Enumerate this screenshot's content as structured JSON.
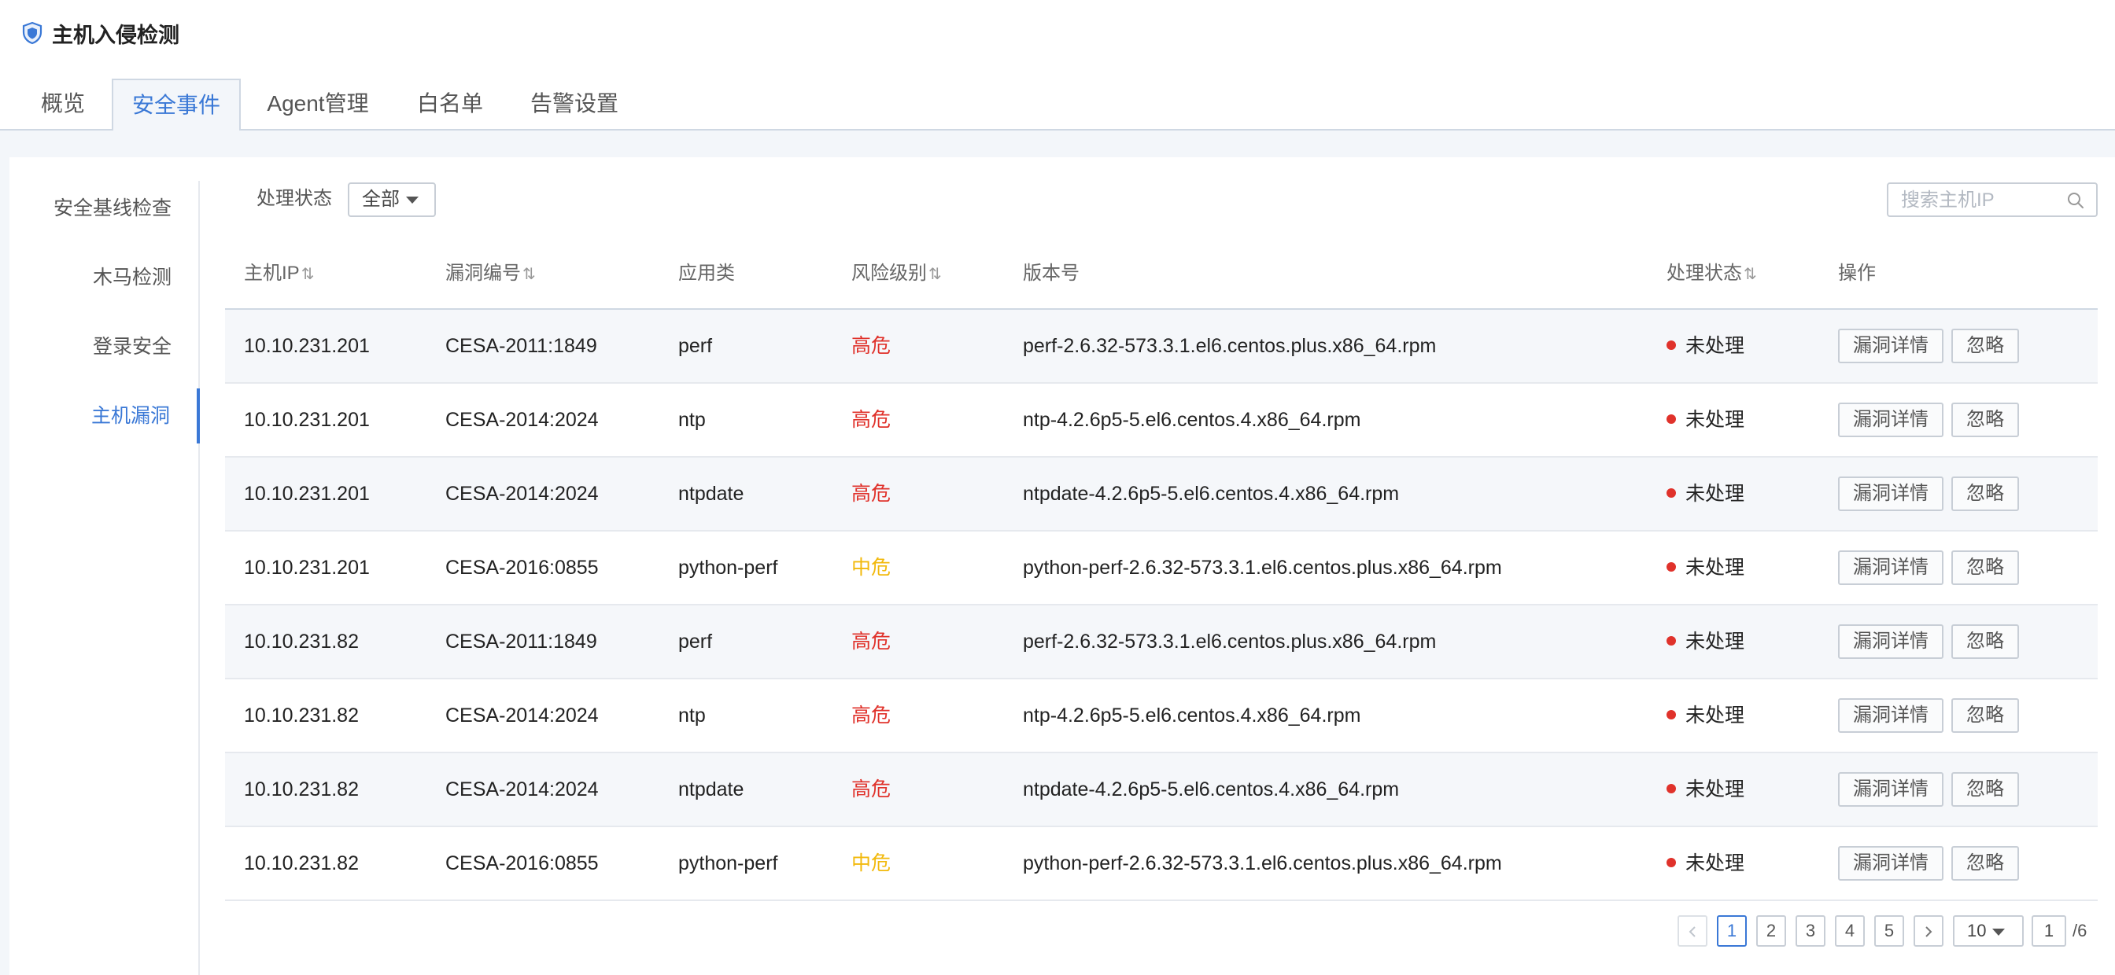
{
  "app": {
    "title": "主机入侵检测",
    "logo_icon": "shield-icon",
    "accent_color": "#3a78d6"
  },
  "tabs": [
    {
      "label": "概览"
    },
    {
      "label": "安全事件",
      "active": true
    },
    {
      "label": "Agent管理"
    },
    {
      "label": "白名单"
    },
    {
      "label": "告警设置"
    }
  ],
  "sidenav": [
    {
      "label": "安全基线检查"
    },
    {
      "label": "木马检测"
    },
    {
      "label": "登录安全"
    },
    {
      "label": "主机漏洞",
      "active": true
    }
  ],
  "filter": {
    "label": "处理状态",
    "selected": "全部"
  },
  "search": {
    "placeholder": "搜索主机IP",
    "value": ""
  },
  "table": {
    "headers": {
      "ip": "主机IP",
      "vuln_id": "漏洞编号",
      "app": "应用类",
      "risk": "风险级别",
      "version": "版本号",
      "status": "处理状态",
      "ops": "操作"
    },
    "sort_icon": "⇅",
    "rows": [
      {
        "ip": "10.10.231.201",
        "vuln_id": "CESA-2011:1849",
        "app": "perf",
        "risk": "高危",
        "risk_level": "high",
        "version": "perf-2.6.32-573.3.1.el6.centos.plus.x86_64.rpm",
        "status": "未处理",
        "detail_label": "漏洞详情",
        "ignore_label": "忽略"
      },
      {
        "ip": "10.10.231.201",
        "vuln_id": "CESA-2014:2024",
        "app": "ntp",
        "risk": "高危",
        "risk_level": "high",
        "version": "ntp-4.2.6p5-5.el6.centos.4.x86_64.rpm",
        "status": "未处理",
        "detail_label": "漏洞详情",
        "ignore_label": "忽略"
      },
      {
        "ip": "10.10.231.201",
        "vuln_id": "CESA-2014:2024",
        "app": "ntpdate",
        "risk": "高危",
        "risk_level": "high",
        "version": "ntpdate-4.2.6p5-5.el6.centos.4.x86_64.rpm",
        "status": "未处理",
        "detail_label": "漏洞详情",
        "ignore_label": "忽略"
      },
      {
        "ip": "10.10.231.201",
        "vuln_id": "CESA-2016:0855",
        "app": "python-perf",
        "risk": "中危",
        "risk_level": "medium",
        "version": "python-perf-2.6.32-573.3.1.el6.centos.plus.x86_64.rpm",
        "status": "未处理",
        "detail_label": "漏洞详情",
        "ignore_label": "忽略"
      },
      {
        "ip": "10.10.231.82",
        "vuln_id": "CESA-2011:1849",
        "app": "perf",
        "risk": "高危",
        "risk_level": "high",
        "version": "perf-2.6.32-573.3.1.el6.centos.plus.x86_64.rpm",
        "status": "未处理",
        "detail_label": "漏洞详情",
        "ignore_label": "忽略"
      },
      {
        "ip": "10.10.231.82",
        "vuln_id": "CESA-2014:2024",
        "app": "ntp",
        "risk": "高危",
        "risk_level": "high",
        "version": "ntp-4.2.6p5-5.el6.centos.4.x86_64.rpm",
        "status": "未处理",
        "detail_label": "漏洞详情",
        "ignore_label": "忽略"
      },
      {
        "ip": "10.10.231.82",
        "vuln_id": "CESA-2014:2024",
        "app": "ntpdate",
        "risk": "高危",
        "risk_level": "high",
        "version": "ntpdate-4.2.6p5-5.el6.centos.4.x86_64.rpm",
        "status": "未处理",
        "detail_label": "漏洞详情",
        "ignore_label": "忽略"
      },
      {
        "ip": "10.10.231.82",
        "vuln_id": "CESA-2016:0855",
        "app": "python-perf",
        "risk": "中危",
        "risk_level": "medium",
        "version": "python-perf-2.6.32-573.3.1.el6.centos.plus.x86_64.rpm",
        "status": "未处理",
        "detail_label": "漏洞详情",
        "ignore_label": "忽略"
      }
    ]
  },
  "pagination": {
    "pages": [
      "1",
      "2",
      "3",
      "4",
      "5"
    ],
    "current": "1",
    "page_size": "10",
    "jump_value": "1",
    "total_label": "/6"
  },
  "colors": {
    "high": "#e0322b",
    "medium": "#f2b90c",
    "status_dot": "#e0322b"
  }
}
